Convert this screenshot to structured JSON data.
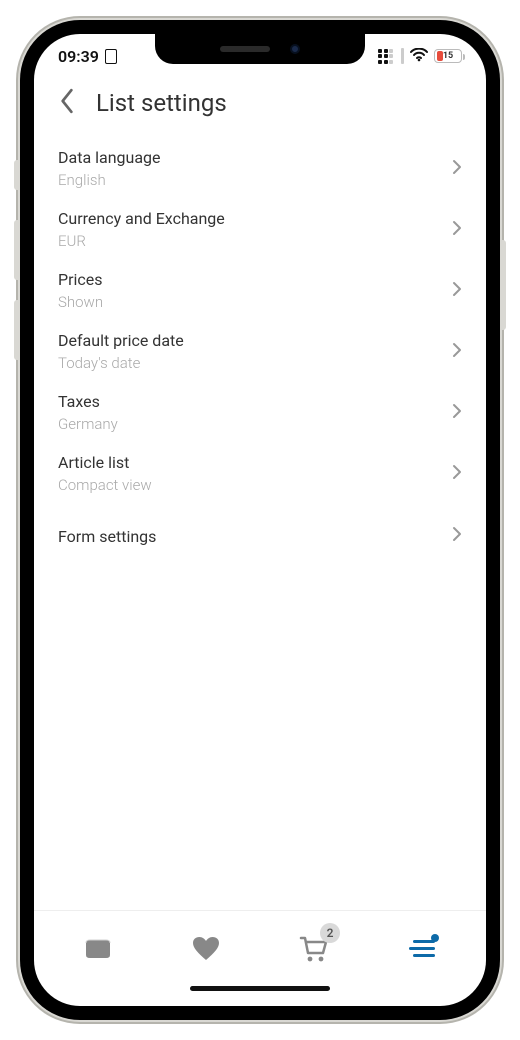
{
  "status": {
    "time": "09:39",
    "battery_pct": "15"
  },
  "header": {
    "title": "List settings"
  },
  "list": {
    "items": [
      {
        "label": "Data language",
        "value": "English"
      },
      {
        "label": "Currency and Exchange",
        "value": "EUR"
      },
      {
        "label": "Prices",
        "value": "Shown"
      },
      {
        "label": "Default price date",
        "value": "Today's date"
      },
      {
        "label": "Taxes",
        "value": "Germany"
      },
      {
        "label": "Article list",
        "value": "Compact view"
      },
      {
        "label": "Form settings",
        "value": null
      }
    ]
  },
  "tabs": {
    "cart_badge": "2"
  }
}
